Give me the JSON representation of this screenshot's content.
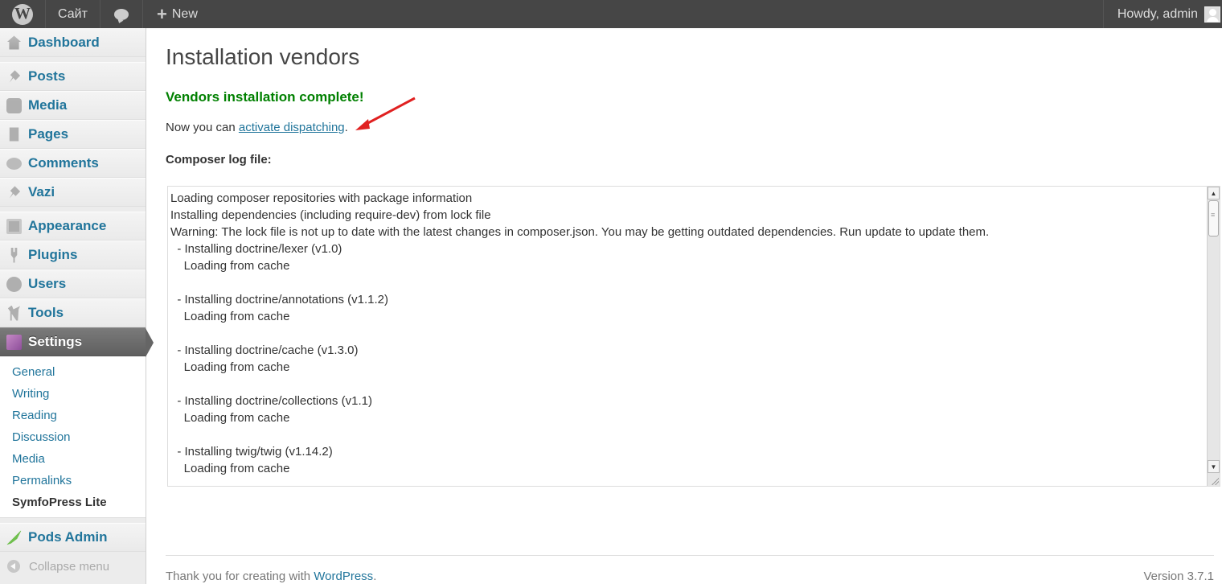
{
  "adminbar": {
    "wp_logo": "W",
    "site": "Сайт",
    "comments_icon": "comment-bubble-icon",
    "new_label": "New",
    "howdy": "Howdy, admin"
  },
  "sidebar": {
    "items": [
      {
        "label": "Dashboard",
        "icon": "dashboard-icon"
      },
      {
        "label": "Posts",
        "icon": "pin-icon"
      },
      {
        "label": "Media",
        "icon": "camera-icon"
      },
      {
        "label": "Pages",
        "icon": "page-icon"
      },
      {
        "label": "Comments",
        "icon": "comment-icon"
      },
      {
        "label": "Vazi",
        "icon": "pin-icon"
      },
      {
        "label": "Appearance",
        "icon": "appearance-icon"
      },
      {
        "label": "Plugins",
        "icon": "plug-icon"
      },
      {
        "label": "Users",
        "icon": "users-icon"
      },
      {
        "label": "Tools",
        "icon": "tools-icon"
      },
      {
        "label": "Settings",
        "icon": "settings-icon"
      }
    ],
    "submenu": [
      "General",
      "Writing",
      "Reading",
      "Discussion",
      "Media",
      "Permalinks",
      "SymfoPress Lite"
    ],
    "pods_admin": "Pods Admin",
    "collapse": "Collapse menu"
  },
  "main": {
    "title": "Installation vendors",
    "success_message": "Vendors installation complete!",
    "now_prefix": "Now you can ",
    "activate_link": "activate dispatching",
    "now_suffix": ".",
    "log_label": "Composer log file:",
    "log_lines": [
      "Loading composer repositories with package information",
      "Installing dependencies (including require-dev) from lock file",
      "Warning: The lock file is not up to date with the latest changes in composer.json. You may be getting outdated dependencies. Run update to update them.",
      "  - Installing doctrine/lexer (v1.0)",
      "    Loading from cache",
      "",
      "  - Installing doctrine/annotations (v1.1.2)",
      "    Loading from cache",
      "",
      "  - Installing doctrine/cache (v1.3.0)",
      "    Loading from cache",
      "",
      "  - Installing doctrine/collections (v1.1)",
      "    Loading from cache",
      "",
      "  - Installing twig/twig (v1.14.2)",
      "    Loading from cache"
    ]
  },
  "footer": {
    "thanks_prefix": "Thank you for creating with ",
    "wordpress_link": "WordPress",
    "thanks_suffix": ".",
    "version": "Version 3.7.1"
  },
  "colors": {
    "accent": "#21759b",
    "success": "#008000",
    "adminbar": "#464646",
    "annotation_arrow": "#e02020"
  }
}
